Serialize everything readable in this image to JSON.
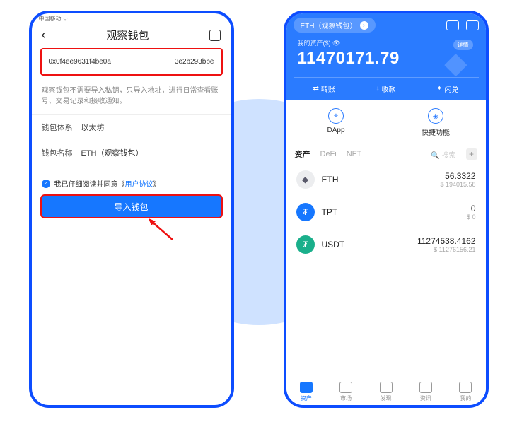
{
  "left": {
    "status": "中国移动 ᯤ",
    "title": "观察钱包",
    "addr_left": "0x0f4ee9631f4be0a",
    "addr_right": "3e2b293bbe",
    "desc": "观察钱包不需要导入私钥，只导入地址，进行日常查看账号、交易记录和接收通知。",
    "chain_label": "钱包体系",
    "chain_value": "以太坊",
    "name_label": "钱包名称",
    "name_value": "ETH（观察钱包）",
    "agree_prefix": "我已仔细阅读并同意《",
    "agree_link": "用户协议",
    "agree_suffix": "》",
    "import_btn": "导入钱包"
  },
  "right": {
    "pill_text": "ETH（观察钱包）",
    "balance_label": "我的资产($)",
    "balance_amount": "11470171.79",
    "detail_label": "详情",
    "actions": {
      "transfer": "转账",
      "receive": "收款",
      "swap": "闪兑"
    },
    "quick": {
      "dapp": "DApp",
      "fast": "快捷功能"
    },
    "tabs": {
      "assets": "资产",
      "defi": "DeFi",
      "nft": "NFT",
      "search_ph": "搜索"
    },
    "assets": [
      {
        "sym": "ETH",
        "amt": "56.3322",
        "fiat": "$ 194015.58",
        "bg": "#ecedef",
        "fg": "#5a5a6b",
        "glyph": "◆"
      },
      {
        "sym": "TPT",
        "amt": "0",
        "fiat": "$ 0",
        "bg": "#1677ff",
        "fg": "#fff",
        "glyph": "₮"
      },
      {
        "sym": "USDT",
        "amt": "11274538.4162",
        "fiat": "$ 11276156.21",
        "bg": "#1aaf8b",
        "fg": "#fff",
        "glyph": "₮"
      }
    ],
    "nav": {
      "assets": "资产",
      "market": "市场",
      "discover": "发现",
      "news": "资讯",
      "me": "我的"
    }
  }
}
